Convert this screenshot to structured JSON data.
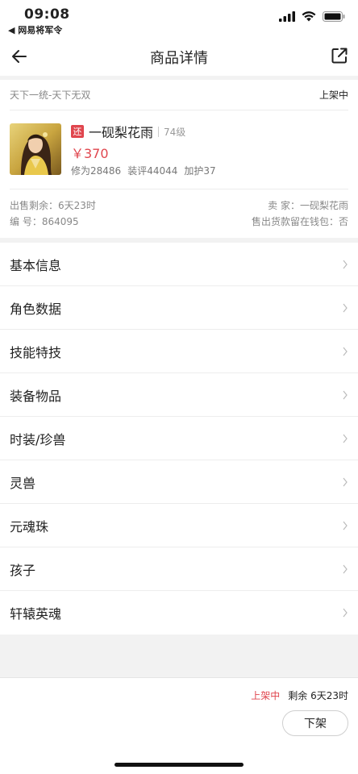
{
  "status_bar": {
    "time": "09:08",
    "back_app": "◀ 网易将军令"
  },
  "nav": {
    "title": "商品详情"
  },
  "listing": {
    "server": "天下一统-天下无双",
    "status": "上架中",
    "tag": "还",
    "role_name": "一砚梨花雨",
    "level": "74级",
    "price": "￥370",
    "stats": [
      "修为28486",
      "装评44044",
      "加护37"
    ],
    "remaining_label": "出售剩余：6天23时",
    "seller_label": "卖 家：一砚梨花雨",
    "number_label": "编 号：864095",
    "wallet_label": "售出货款留在钱包：否"
  },
  "menu": [
    {
      "label": "基本信息"
    },
    {
      "label": "角色数据"
    },
    {
      "label": "技能特技"
    },
    {
      "label": "装备物品"
    },
    {
      "label": "时装/珍兽"
    },
    {
      "label": "灵兽"
    },
    {
      "label": "元魂珠"
    },
    {
      "label": "孩子"
    },
    {
      "label": "轩辕英魂"
    }
  ],
  "bottom": {
    "status": "上架中",
    "remaining": "剩余 6天23时",
    "delist_button": "下架"
  },
  "colors": {
    "accent": "#e0464e",
    "background": "#f2f2f2"
  }
}
